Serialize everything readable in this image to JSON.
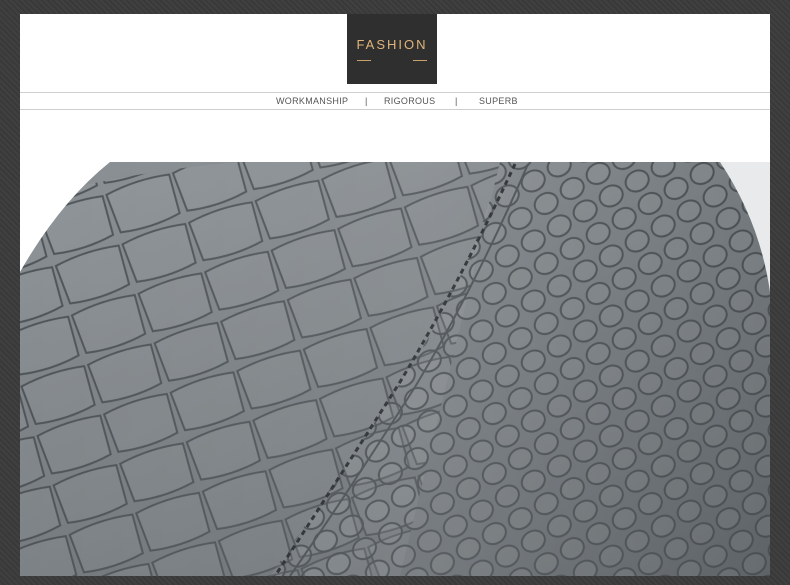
{
  "header": {
    "badge_title": "FASHION",
    "taglines": [
      "WORKMANSHIP",
      "|",
      "RIGOROUS",
      "|",
      "SUPERB"
    ]
  },
  "colors": {
    "background": "#3b3b3b",
    "panel": "#ffffff",
    "badge": "#2f2f2f",
    "badge_text": "#e0b47a",
    "leather": "#7a8084",
    "stitching": "#2a2d30"
  },
  "photo": {
    "subject": "grey crocodile-embossed leather with stitched seam"
  }
}
